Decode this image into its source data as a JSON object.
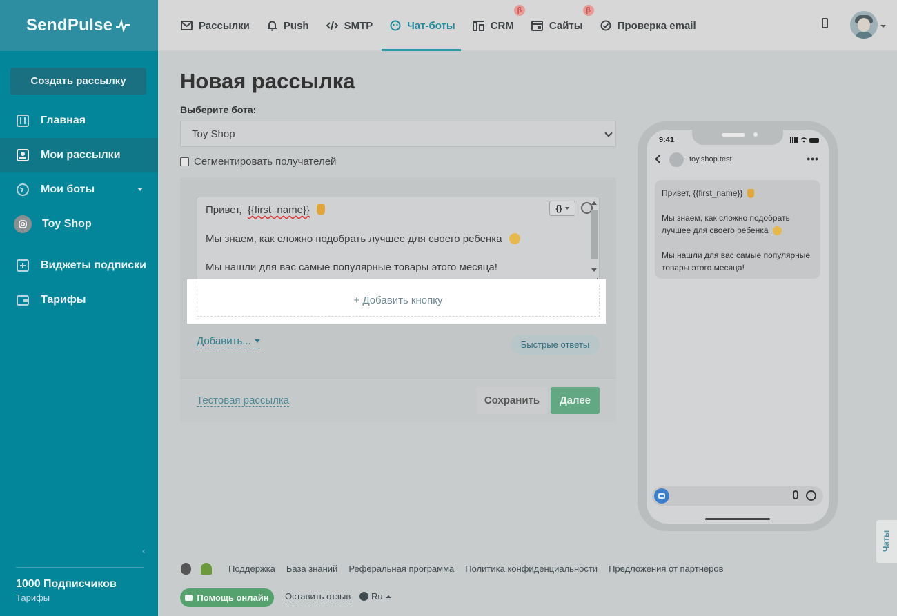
{
  "sidebar": {
    "logo": "SendPulse",
    "create_button": "Создать рассылку",
    "items": [
      {
        "label": "Главная",
        "icon": "sliders-icon"
      },
      {
        "label": "Мои рассылки",
        "icon": "contacts-icon"
      },
      {
        "label": "Мои боты",
        "icon": "globe-icon"
      },
      {
        "label": "Toy Shop",
        "icon": "instagram-icon"
      },
      {
        "label": "Виджеты подписки",
        "icon": "widget-icon"
      },
      {
        "label": "Тарифы",
        "icon": "wallet-icon"
      }
    ],
    "subscribers": "1000 Подписчиков",
    "tariffs_link": "Тарифы"
  },
  "topnav": {
    "items": [
      {
        "label": "Рассылки",
        "icon": "mail-icon"
      },
      {
        "label": "Push",
        "icon": "bell-icon"
      },
      {
        "label": "SMTP",
        "icon": "code-icon"
      },
      {
        "label": "Чат-боты",
        "icon": "chatbot-icon"
      },
      {
        "label": "CRM",
        "icon": "crm-icon"
      },
      {
        "label": "Сайты",
        "icon": "site-icon"
      },
      {
        "label": "Проверка email",
        "icon": "check-icon"
      }
    ],
    "beta_badge": "β"
  },
  "main": {
    "title": "Новая рассылка",
    "bot_label": "Выберите бота:",
    "bot_selected": "Toy Shop",
    "segment_label": "Сегментировать получателей",
    "message": {
      "line1_prefix": "Привет,",
      "line1_var": "{{first_name}}",
      "line2": "Мы знаем, как сложно подобрать лучшее для своего ребенка",
      "line3": "Мы нашли для вас самые популярные товары этого месяца!"
    },
    "var_button": "{}",
    "add_button": "+ Добавить кнопку",
    "add_more": "Добавить...",
    "quick_replies": "Быстрые ответы",
    "test_link": "Тестовая рассылка",
    "save": "Сохранить",
    "next": "Далее"
  },
  "phone": {
    "time": "9:41",
    "chat_name": "toy.shop.test",
    "menu": "•••",
    "bubble": {
      "line1": "Привет,  {{first_name}}",
      "line2": "Мы знаем, как сложно подобрать лучшее для своего ребенка",
      "line3": "Мы нашли для вас самые популярные товары этого месяца!"
    }
  },
  "chats_tab": "Чаты",
  "footer": {
    "links": [
      "Поддержка",
      "База знаний",
      "Реферальная программа",
      "Политика конфиденциальности",
      "Предложения от партнеров"
    ],
    "help": "Помощь онлайн",
    "feedback": "Оставить отзыв",
    "lang": "Ru"
  }
}
